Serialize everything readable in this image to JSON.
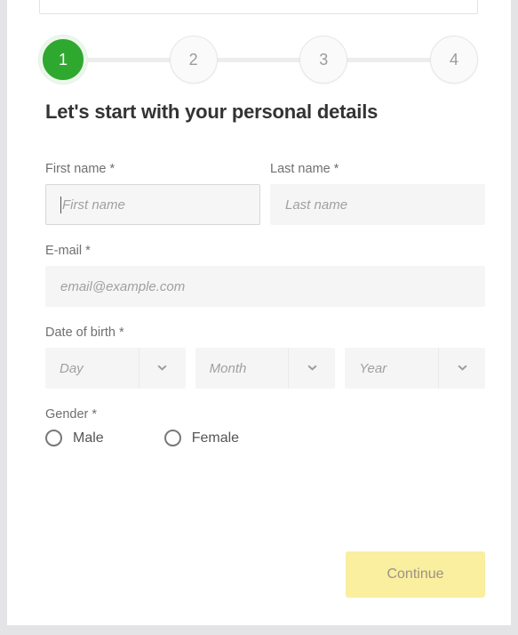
{
  "theme": {
    "page_background": "#e4e4e6",
    "card_background": "#ffffff",
    "active_step_color": "#2fa82f",
    "button_color": "#faee9f",
    "button_text_color": "#9a9384",
    "field_background": "#f5f5f5",
    "label_color": "#6f6f6f"
  },
  "stepper": {
    "steps": [
      {
        "number": "1",
        "state": "active"
      },
      {
        "number": "2",
        "state": "inactive"
      },
      {
        "number": "3",
        "state": "inactive"
      },
      {
        "number": "4",
        "state": "inactive"
      }
    ]
  },
  "heading": "Let's start with your personal details",
  "form": {
    "first_name": {
      "label": "First name *",
      "placeholder": "First name",
      "value": "",
      "focused": true
    },
    "last_name": {
      "label": "Last name *",
      "placeholder": "Last name",
      "value": ""
    },
    "email": {
      "label": "E-mail *",
      "placeholder": "email@example.com",
      "value": ""
    },
    "date_of_birth": {
      "label": "Date of birth *",
      "day": {
        "selected": "Day"
      },
      "month": {
        "selected": "Month"
      },
      "year": {
        "selected": "Year"
      }
    },
    "gender": {
      "label": "Gender *",
      "options": [
        {
          "label": "Male",
          "selected": false
        },
        {
          "label": "Female",
          "selected": false
        }
      ]
    }
  },
  "actions": {
    "continue_label": "Continue"
  }
}
